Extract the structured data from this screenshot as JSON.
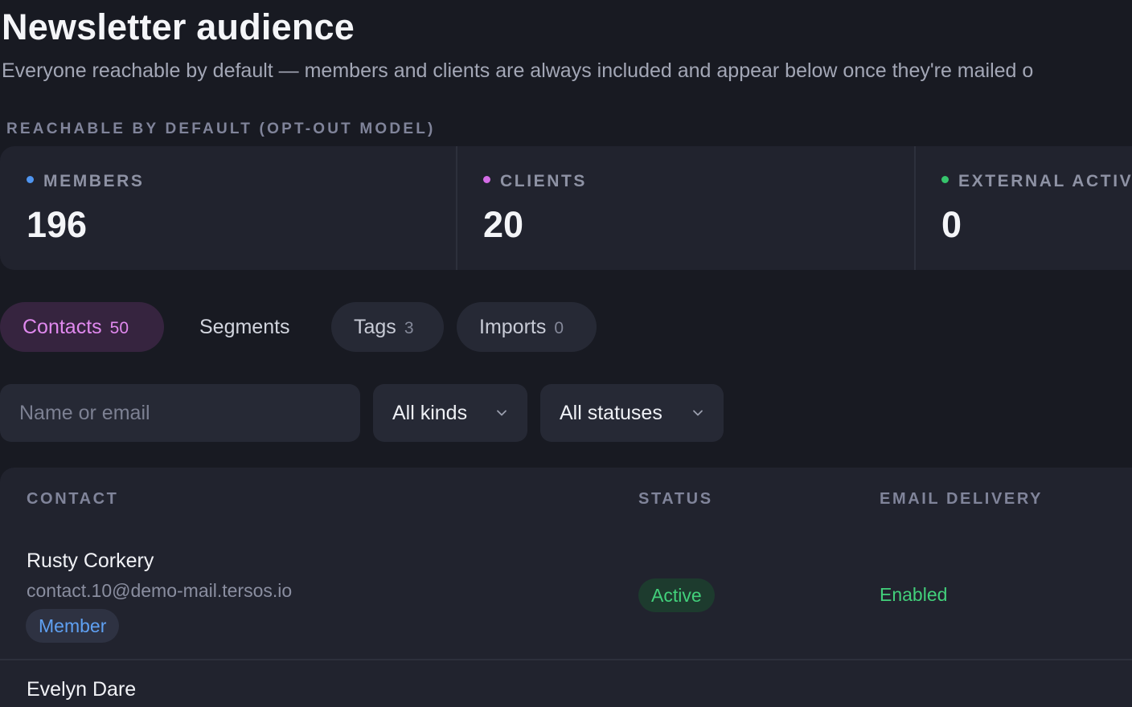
{
  "header": {
    "title": "Newsletter audience",
    "subtitle": "Everyone reachable by default — members and clients are always included and appear below once they're mailed o"
  },
  "reachable": {
    "label": "REACHABLE BY DEFAULT (OPT-OUT MODEL)",
    "stats": [
      {
        "label": "MEMBERS",
        "value": "196",
        "color": "#4f95f0"
      },
      {
        "label": "CLIENTS",
        "value": "20",
        "color": "#d46ce6"
      },
      {
        "label": "EXTERNAL ACTIVE",
        "value": "0",
        "color": "#36c46c"
      }
    ]
  },
  "tabs": [
    {
      "label": "Contacts",
      "count": "50",
      "active": true
    },
    {
      "label": "Segments",
      "count": "",
      "active": false
    },
    {
      "label": "Tags",
      "count": "3",
      "active": false
    },
    {
      "label": "Imports",
      "count": "0",
      "active": false
    }
  ],
  "filters": {
    "search_placeholder": "Name or email",
    "search_value": "",
    "kind_selected": "All kinds",
    "status_selected": "All statuses",
    "chevron_icon": "chevron-down-icon"
  },
  "table": {
    "columns": [
      "CONTACT",
      "STATUS",
      "EMAIL DELIVERY"
    ],
    "rows": [
      {
        "name": "Rusty Corkery",
        "email": "contact.10@demo-mail.tersos.io",
        "kind": "Member",
        "status": "Active",
        "delivery": "Enabled"
      },
      {
        "name": "Evelyn Dare"
      }
    ]
  },
  "colors": {
    "background": "#181a22",
    "card": "#21232e",
    "accent_tab": "#e089ee",
    "member_badge": "#5fa0f2",
    "active_green": "#42d07b"
  }
}
